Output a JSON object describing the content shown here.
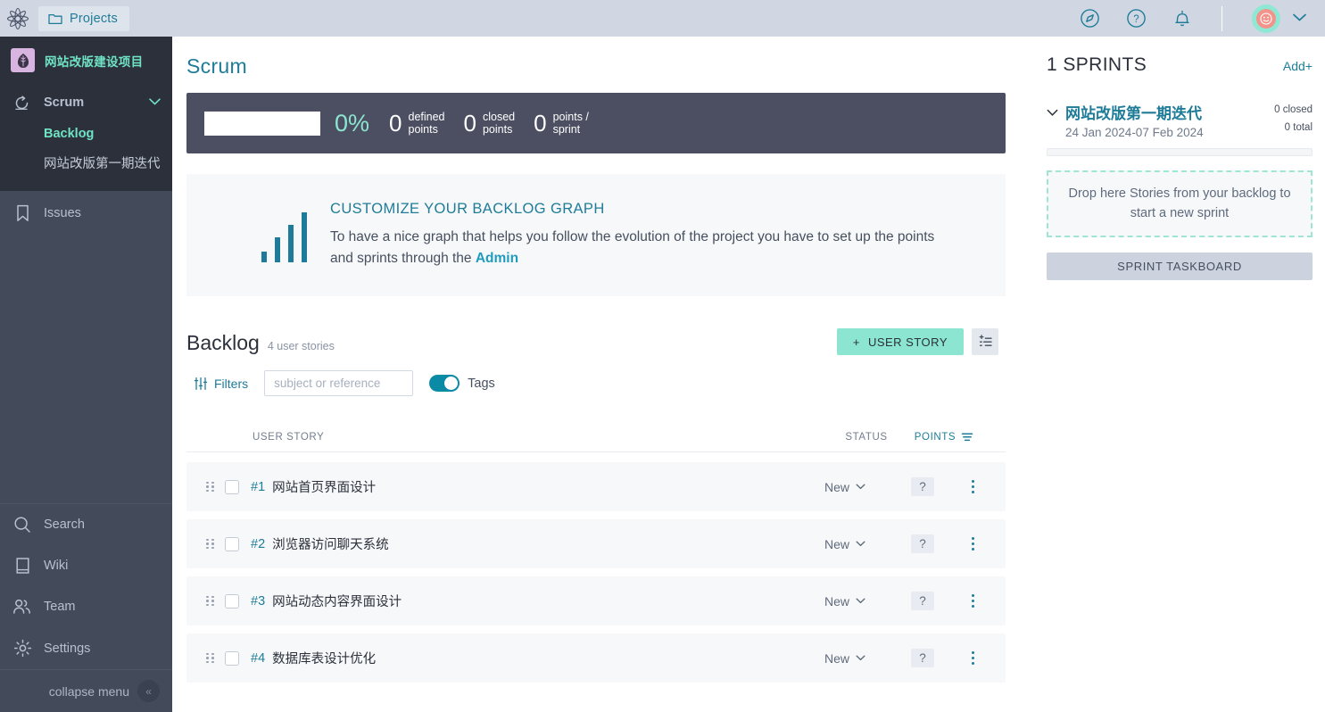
{
  "topbar": {
    "logo_icon": "taiga-star-logo",
    "projects_label": "Projects",
    "icons": [
      "compass-icon",
      "help-icon",
      "notifications-bell-icon"
    ],
    "avatar_name": "user-avatar"
  },
  "sidebar": {
    "project_name": "网站改版建设项目",
    "scrum": {
      "label": "Scrum",
      "items": [
        {
          "label": "Backlog",
          "selected": true
        },
        {
          "label": "网站改版第一期迭代",
          "selected": false
        }
      ]
    },
    "issues_label": "Issues",
    "bottom_items": [
      {
        "label": "Search",
        "icon": "search-icon"
      },
      {
        "label": "Wiki",
        "icon": "wiki-book-icon"
      },
      {
        "label": "Team",
        "icon": "team-people-icon"
      },
      {
        "label": "Settings",
        "icon": "gear-icon"
      }
    ],
    "collapse_label": "collapse menu"
  },
  "main": {
    "page_title": "Scrum",
    "stats": {
      "progress_percent": "0%",
      "progress_fill": 0,
      "items": [
        {
          "value": "0",
          "line1": "defined",
          "line2": "points"
        },
        {
          "value": "0",
          "line1": "closed",
          "line2": "points"
        },
        {
          "value": "0",
          "line1": "points /",
          "line2": "sprint"
        }
      ]
    },
    "banner": {
      "heading": "CUSTOMIZE YOUR BACKLOG GRAPH",
      "body_part1": "To have a nice graph that helps you follow the evolution of the project you have to set up the points and sprints through the ",
      "link_label": "Admin",
      "bars": [
        12,
        28,
        42,
        56
      ]
    },
    "backlog": {
      "title": "Backlog",
      "count_label": "4 user stories",
      "add_story_label": "USER STORY",
      "add_story_plus": "+",
      "bulk_icon": "add-multiple-icon",
      "filters_label": "Filters",
      "search_placeholder": "subject or reference",
      "search_value": "",
      "tags_label": "Tags",
      "tags_on": true,
      "columns": {
        "user_story": "USER STORY",
        "status": "STATUS",
        "points": "POINTS"
      },
      "rows": [
        {
          "ref": "#1",
          "subject": "网站首页界面设计",
          "status": "New",
          "points": "?"
        },
        {
          "ref": "#2",
          "subject": "浏览器访问聊天系统",
          "status": "New",
          "points": "?"
        },
        {
          "ref": "#3",
          "subject": "网站动态内容界面设计",
          "status": "New",
          "points": "?"
        },
        {
          "ref": "#4",
          "subject": "数据库表设计优化",
          "status": "New",
          "points": "?"
        }
      ]
    }
  },
  "rightpanel": {
    "title": "1 SPRINTS",
    "add_label": "Add",
    "add_plus": "+",
    "sprint": {
      "name": "网站改版第一期迭代",
      "dates": "24 Jan 2024-07 Feb 2024",
      "closed_label": "0 closed",
      "total_label": "0 total",
      "progress_fill": 0
    },
    "dropzone_text": "Drop here Stories from your backlog to start a new sprint",
    "taskboard_label": "SPRINT TASKBOARD"
  },
  "colors": {
    "accent_green": "#8ce5d0",
    "accent_teal": "#1f7c98",
    "sidebar_dark": "#434a59",
    "sidebar_darker": "#2b303b",
    "stats_bg": "#4b4f61",
    "topbar_bg": "#d0d7e3"
  }
}
